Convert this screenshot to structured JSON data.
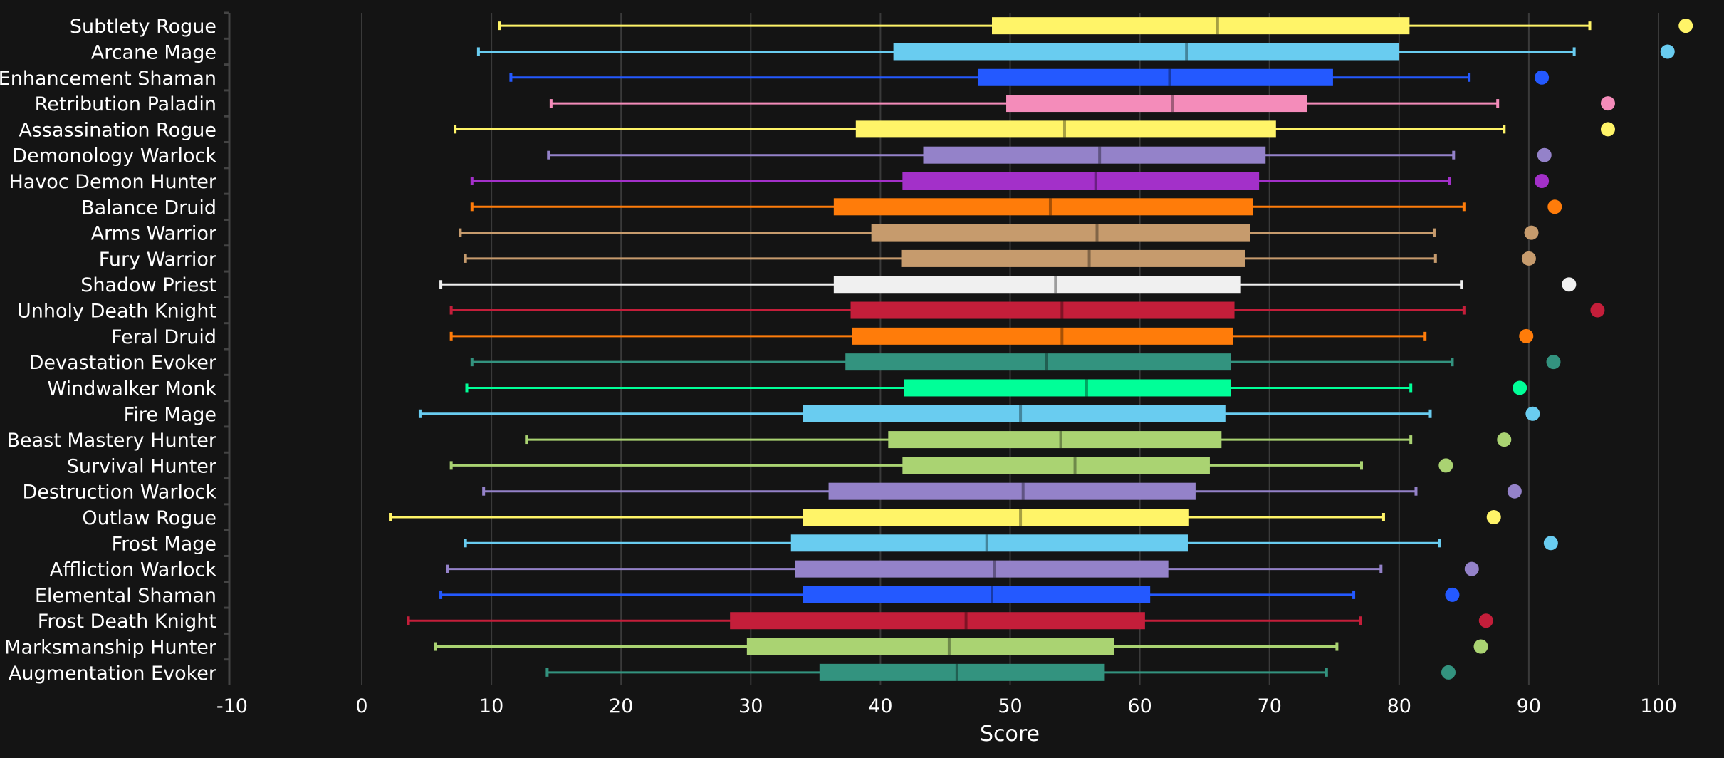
{
  "chart_data": {
    "type": "boxplot",
    "title": "",
    "xlabel": "Score",
    "ylabel": "",
    "xlim": [
      -10,
      104
    ],
    "x_ticks": [
      "-10",
      "0",
      "10",
      "20",
      "30",
      "40",
      "50",
      "60",
      "70",
      "80",
      "90",
      "100"
    ],
    "x_tick_values": [
      -10,
      0,
      10,
      20,
      30,
      40,
      50,
      60,
      70,
      80,
      90,
      100
    ],
    "grid": "vertical",
    "legend": "none",
    "series": [
      {
        "name": "Subtlety Rogue",
        "color": "#fff468",
        "whisker_low": 10.6,
        "q1": 48.6,
        "median": 66.0,
        "q3": 80.8,
        "whisker_high": 94.7,
        "outlier": 102.1
      },
      {
        "name": "Arcane Mage",
        "color": "#69ccf0",
        "whisker_low": 9.0,
        "q1": 41.0,
        "median": 63.6,
        "q3": 80.0,
        "whisker_high": 93.5,
        "outlier": 100.7
      },
      {
        "name": "Enhancement Shaman",
        "color": "#2459ff",
        "whisker_low": 11.5,
        "q1": 47.5,
        "median": 62.3,
        "q3": 74.9,
        "whisker_high": 85.4,
        "outlier": 91.0
      },
      {
        "name": "Retribution Paladin",
        "color": "#f48cba",
        "whisker_low": 14.6,
        "q1": 49.7,
        "median": 62.5,
        "q3": 72.9,
        "whisker_high": 87.6,
        "outlier": 96.1
      },
      {
        "name": "Assassination Rogue",
        "color": "#fff468",
        "whisker_low": 7.2,
        "q1": 38.1,
        "median": 54.2,
        "q3": 70.5,
        "whisker_high": 88.1,
        "outlier": 96.1
      },
      {
        "name": "Demonology Warlock",
        "color": "#9482c9",
        "whisker_low": 14.4,
        "q1": 43.3,
        "median": 56.9,
        "q3": 69.7,
        "whisker_high": 84.2,
        "outlier": 91.2
      },
      {
        "name": "Havoc Demon Hunter",
        "color": "#a330c9",
        "whisker_low": 8.5,
        "q1": 41.7,
        "median": 56.6,
        "q3": 69.2,
        "whisker_high": 83.9,
        "outlier": 91.0
      },
      {
        "name": "Balance Druid",
        "color": "#ff7c0a",
        "whisker_low": 8.5,
        "q1": 36.4,
        "median": 53.1,
        "q3": 68.7,
        "whisker_high": 85.0,
        "outlier": 92.0
      },
      {
        "name": "Arms Warrior",
        "color": "#c69b6d",
        "whisker_low": 7.6,
        "q1": 39.3,
        "median": 56.7,
        "q3": 68.5,
        "whisker_high": 82.7,
        "outlier": 90.2
      },
      {
        "name": "Fury Warrior",
        "color": "#c69b6d",
        "whisker_low": 8.0,
        "q1": 41.6,
        "median": 56.1,
        "q3": 68.1,
        "whisker_high": 82.8,
        "outlier": 90.0
      },
      {
        "name": "Shadow Priest",
        "color": "#f0f0f0",
        "whisker_low": 6.1,
        "q1": 36.4,
        "median": 53.5,
        "q3": 67.8,
        "whisker_high": 84.8,
        "outlier": 93.1
      },
      {
        "name": "Unholy Death Knight",
        "color": "#c41e3a",
        "whisker_low": 6.9,
        "q1": 37.7,
        "median": 54.0,
        "q3": 67.3,
        "whisker_high": 85.0,
        "outlier": 95.3
      },
      {
        "name": "Feral Druid",
        "color": "#ff7c0a",
        "whisker_low": 6.9,
        "q1": 37.8,
        "median": 54.0,
        "q3": 67.2,
        "whisker_high": 82.0,
        "outlier": 89.8
      },
      {
        "name": "Devastation Evoker",
        "color": "#33937f",
        "whisker_low": 8.5,
        "q1": 37.3,
        "median": 52.8,
        "q3": 67.0,
        "whisker_high": 84.1,
        "outlier": 91.9
      },
      {
        "name": "Windwalker Monk",
        "color": "#00ff98",
        "whisker_low": 8.1,
        "q1": 41.8,
        "median": 55.9,
        "q3": 67.0,
        "whisker_high": 80.9,
        "outlier": 89.3
      },
      {
        "name": "Fire Mage",
        "color": "#69ccf0",
        "whisker_low": 4.5,
        "q1": 34.0,
        "median": 50.8,
        "q3": 66.6,
        "whisker_high": 82.4,
        "outlier": 90.3
      },
      {
        "name": "Beast Mastery Hunter",
        "color": "#aad372",
        "whisker_low": 12.7,
        "q1": 40.6,
        "median": 53.9,
        "q3": 66.3,
        "whisker_high": 80.9,
        "outlier": 88.1
      },
      {
        "name": "Survival Hunter",
        "color": "#aad372",
        "whisker_low": 6.9,
        "q1": 41.7,
        "median": 55.0,
        "q3": 65.4,
        "whisker_high": 77.1,
        "outlier": 83.6
      },
      {
        "name": "Destruction Warlock",
        "color": "#9482c9",
        "whisker_low": 9.4,
        "q1": 36.0,
        "median": 51.0,
        "q3": 64.3,
        "whisker_high": 81.3,
        "outlier": 88.9
      },
      {
        "name": "Outlaw Rogue",
        "color": "#fff468",
        "whisker_low": 2.2,
        "q1": 34.0,
        "median": 50.8,
        "q3": 63.8,
        "whisker_high": 78.8,
        "outlier": 87.3
      },
      {
        "name": "Frost Mage",
        "color": "#69ccf0",
        "whisker_low": 8.0,
        "q1": 33.1,
        "median": 48.2,
        "q3": 63.7,
        "whisker_high": 83.1,
        "outlier": 91.7
      },
      {
        "name": "Affliction Warlock",
        "color": "#9482c9",
        "whisker_low": 6.6,
        "q1": 33.4,
        "median": 48.8,
        "q3": 62.2,
        "whisker_high": 78.6,
        "outlier": 85.6
      },
      {
        "name": "Elemental Shaman",
        "color": "#2459ff",
        "whisker_low": 6.1,
        "q1": 34.0,
        "median": 48.6,
        "q3": 60.8,
        "whisker_high": 76.5,
        "outlier": 84.1
      },
      {
        "name": "Frost Death Knight",
        "color": "#c41e3a",
        "whisker_low": 3.6,
        "q1": 28.4,
        "median": 46.6,
        "q3": 60.4,
        "whisker_high": 77.0,
        "outlier": 86.7
      },
      {
        "name": "Marksmanship Hunter",
        "color": "#aad372",
        "whisker_low": 5.7,
        "q1": 29.7,
        "median": 45.3,
        "q3": 58.0,
        "whisker_high": 75.2,
        "outlier": 86.3
      },
      {
        "name": "Augmentation Evoker",
        "color": "#33937f",
        "whisker_low": 14.3,
        "q1": 35.3,
        "median": 45.9,
        "q3": 57.3,
        "whisker_high": 74.4,
        "outlier": 83.8
      }
    ]
  }
}
